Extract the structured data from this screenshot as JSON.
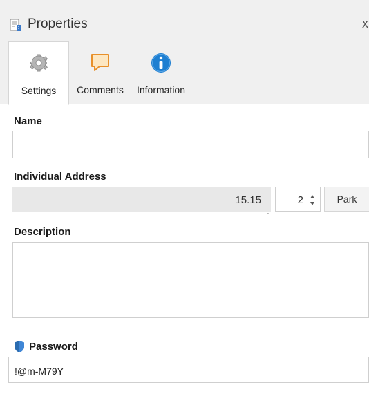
{
  "window": {
    "title": "Properties",
    "close_glyph": "x"
  },
  "tabs": [
    {
      "label": "Settings",
      "icon": "gear-icon",
      "active": true
    },
    {
      "label": "Comments",
      "icon": "comment-icon",
      "active": false
    },
    {
      "label": "Information",
      "icon": "info-icon",
      "active": false
    }
  ],
  "name": {
    "label": "Name",
    "value": ""
  },
  "individual_address": {
    "label": "Individual Address",
    "prefix": "15.15",
    "separator": ".",
    "device_number": "2",
    "park_label": "Park"
  },
  "description": {
    "label": "Description",
    "value": ""
  },
  "password": {
    "label": "Password",
    "icon": "shield-icon",
    "value": "!@m-M79Y"
  },
  "colors": {
    "accent_blue": "#1e7fd1",
    "comment_orange": "#e8902a",
    "shield_blue": "#2b6cb0"
  }
}
